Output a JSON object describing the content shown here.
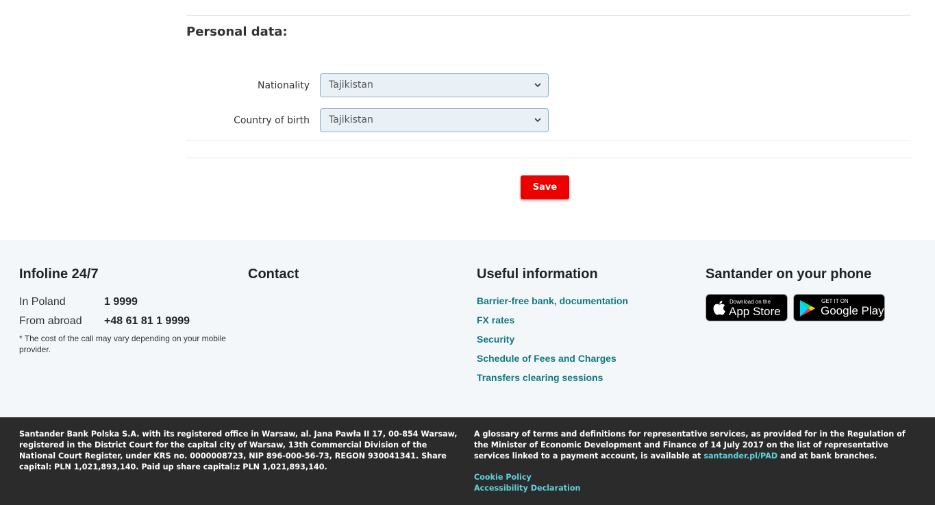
{
  "form": {
    "section_title": "Personal data:",
    "fields": [
      {
        "label": "Nationality",
        "value": "Tajikistan"
      },
      {
        "label": "Country of birth",
        "value": "Tajikistan"
      }
    ],
    "save_label": "Save"
  },
  "footer": {
    "infoline": {
      "title": "Infoline 24/7",
      "rows": [
        {
          "label": "In Poland",
          "number": "1 9999"
        },
        {
          "label": "From abroad",
          "number": "+48 61 81 1 9999"
        }
      ],
      "note": "* The cost of the call may vary depending on your mobile provider."
    },
    "contact": {
      "title": "Contact"
    },
    "useful": {
      "title": "Useful information",
      "links": [
        "Barrier-free bank, documentation",
        "FX rates",
        "Security",
        "Schedule of Fees and Charges",
        "Transfers clearing sessions"
      ]
    },
    "phone": {
      "title": "Santander on your phone",
      "app_store": {
        "small": "Download on the",
        "big": "App Store"
      },
      "google_play": {
        "small": "GET IT ON",
        "big": "Google Play"
      }
    },
    "legal_left": "Santander Bank Polska S.A. with its registered office in Warsaw, al. Jana Pawła II 17, 00-854 Warsaw, registered in the District Court for the capital city of Warsaw, 13th Commercial Division of the National Court Register, under KRS no. 0000008723, NIP 896-000-56-73, REGON 930041341. Share capital: PLN 1,021,893,140. Paid up share capital:z PLN 1,021,893,140.",
    "legal_right_text": "A glossary of terms and definitions for representative services, as provided for in the Regulation of the Minister of Economic Development and Finance of 14 July 2017 on the list of representative services linked to a payment account, is available at",
    "legal_right_link": "santander.pl/PAD",
    "legal_right_tail": "and at bank branches.",
    "cookie_policy": "Cookie Policy",
    "accessibility": "Accessibility Declaration"
  },
  "colors": {
    "brand_red": "#ec0000",
    "link_teal": "#12787f",
    "dark_link": "#5fd3dd",
    "footer_light_bg": "#f3f7fa",
    "footer_dark_bg": "#2b2b2b"
  }
}
